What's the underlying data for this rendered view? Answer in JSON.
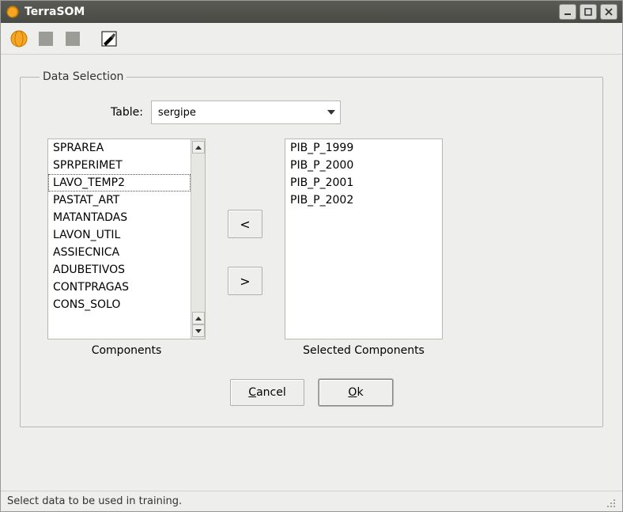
{
  "window": {
    "title": "TerraSOM"
  },
  "fieldset": {
    "legend": "Data Selection",
    "table_label": "Table:",
    "table_value": "sergipe"
  },
  "components_label": "Components",
  "selected_label": "Selected Components",
  "components": [
    "SPRAREA",
    "SPRPERIMET",
    "LAVO_TEMP2",
    "PASTAT_ART",
    "MATANTADAS",
    "LAVON_UTIL",
    "ASSIECNICA",
    "ADUBETIVOS",
    "CONTPRAGAS",
    "CONS_SOLO"
  ],
  "components_selected_index": 2,
  "selected_components": [
    "PIB_P_1999",
    "PIB_P_2000",
    "PIB_P_2001",
    "PIB_P_2002"
  ],
  "buttons": {
    "move_left": "<",
    "move_right": ">",
    "cancel": "Cancel",
    "ok": "Ok"
  },
  "status": "Select data to be used in training."
}
